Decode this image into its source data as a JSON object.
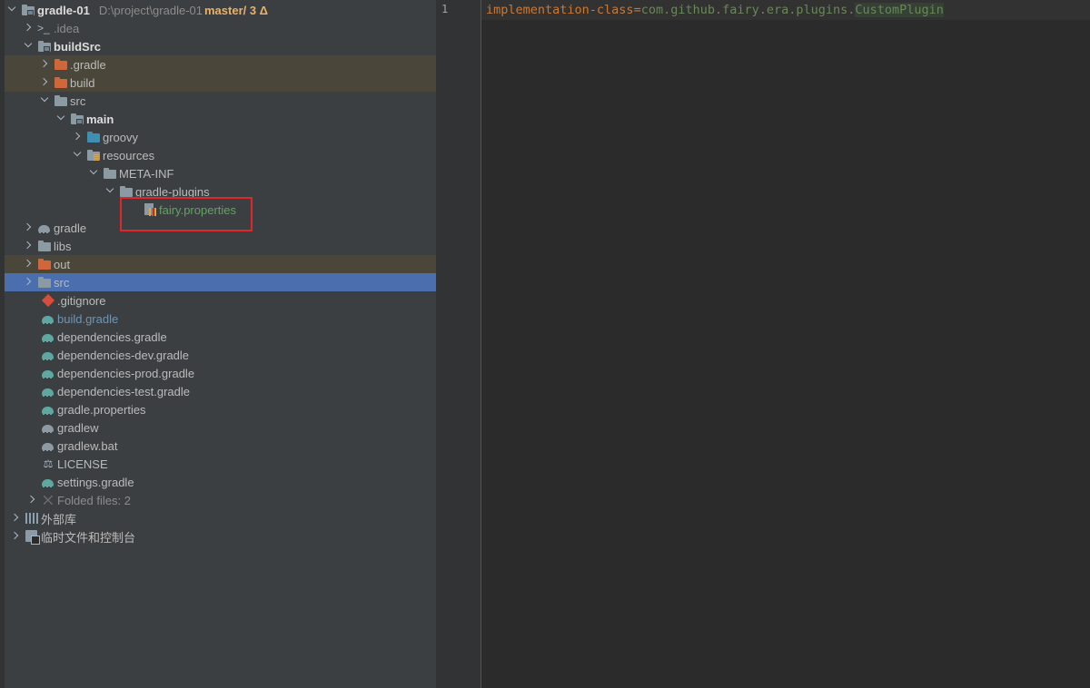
{
  "project_tree": {
    "root": {
      "name": "gradle-01",
      "path": "D:\\project\\gradle-01",
      "vcs": "master/ 3 Δ"
    },
    "items": [
      {
        "label": "gradle-01",
        "depth": 0,
        "arrow": "down",
        "icon": "module-folder-icon"
      },
      {
        "label": ".idea",
        "depth": 1,
        "arrow": "right",
        "icon": "idea-folder-icon"
      },
      {
        "label": "buildSrc",
        "depth": 1,
        "arrow": "down",
        "icon": "module-folder-icon"
      },
      {
        "label": ".gradle",
        "depth": 2,
        "arrow": "right",
        "icon": "excluded-folder-icon"
      },
      {
        "label": "build",
        "depth": 2,
        "arrow": "right",
        "icon": "excluded-folder-icon"
      },
      {
        "label": "src",
        "depth": 2,
        "arrow": "down",
        "icon": "folder-icon"
      },
      {
        "label": "main",
        "depth": 3,
        "arrow": "down",
        "icon": "module-folder-icon"
      },
      {
        "label": "groovy",
        "depth": 4,
        "arrow": "right",
        "icon": "source-folder-icon"
      },
      {
        "label": "resources",
        "depth": 4,
        "arrow": "down",
        "icon": "resources-folder-icon"
      },
      {
        "label": "META-INF",
        "depth": 5,
        "arrow": "down",
        "icon": "folder-icon"
      },
      {
        "label": "gradle-plugins",
        "depth": 6,
        "arrow": "down",
        "icon": "folder-icon"
      },
      {
        "label": "fairy.properties",
        "depth": 7,
        "arrow": "none",
        "icon": "properties-file-icon"
      },
      {
        "label": "gradle",
        "depth": 1,
        "arrow": "right",
        "icon": "gradle-folder-icon"
      },
      {
        "label": "libs",
        "depth": 1,
        "arrow": "right",
        "icon": "folder-icon"
      },
      {
        "label": "out",
        "depth": 1,
        "arrow": "right",
        "icon": "excluded-folder-icon"
      },
      {
        "label": "src",
        "depth": 1,
        "arrow": "right",
        "icon": "folder-icon"
      },
      {
        "label": ".gitignore",
        "depth": 1,
        "arrow": "none",
        "icon": "git-icon"
      },
      {
        "label": "build.gradle",
        "depth": 1,
        "arrow": "none",
        "icon": "gradle-icon"
      },
      {
        "label": "dependencies.gradle",
        "depth": 1,
        "arrow": "none",
        "icon": "gradle-icon"
      },
      {
        "label": "dependencies-dev.gradle",
        "depth": 1,
        "arrow": "none",
        "icon": "gradle-icon"
      },
      {
        "label": "dependencies-prod.gradle",
        "depth": 1,
        "arrow": "none",
        "icon": "gradle-icon"
      },
      {
        "label": "dependencies-test.gradle",
        "depth": 1,
        "arrow": "none",
        "icon": "gradle-icon"
      },
      {
        "label": "gradle.properties",
        "depth": 1,
        "arrow": "none",
        "icon": "gradle-icon"
      },
      {
        "label": "gradlew",
        "depth": 1,
        "arrow": "none",
        "icon": "gradle-script-icon"
      },
      {
        "label": "gradlew.bat",
        "depth": 1,
        "arrow": "none",
        "icon": "gradle-script-icon"
      },
      {
        "label": "LICENSE",
        "depth": 1,
        "arrow": "none",
        "icon": "license-icon"
      },
      {
        "label": "settings.gradle",
        "depth": 1,
        "arrow": "none",
        "icon": "gradle-icon"
      },
      {
        "label": "Folded files: 2",
        "depth": 1,
        "arrow": "right",
        "icon": "folded-icon"
      },
      {
        "label": "外部库",
        "depth": 0,
        "arrow": "right",
        "icon": "library-icon"
      },
      {
        "label": "临时文件和控制台",
        "depth": 0,
        "arrow": "right",
        "icon": "scratch-icon"
      }
    ]
  },
  "editor": {
    "line_number": "1",
    "key": "implementation-class",
    "equals": "=",
    "value_package": "com.github.fairy.era.plugins.",
    "value_class": "CustomPlugin"
  }
}
